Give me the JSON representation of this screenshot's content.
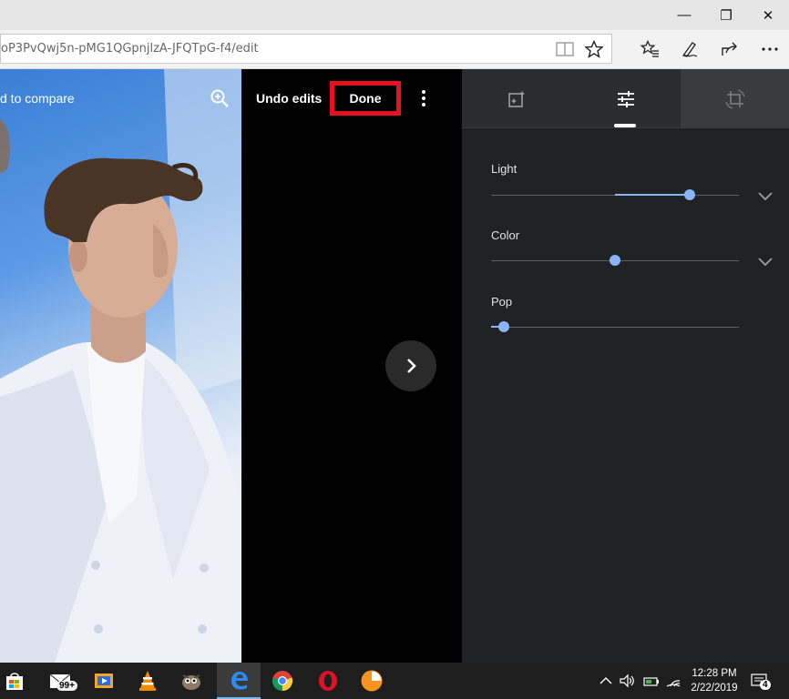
{
  "browser": {
    "window_buttons": {
      "minimize": "—",
      "maximize": "❐",
      "close": "✕"
    },
    "address": "oP3PvQwj5n-pMG1QGpnjlzA-JFQTpG-f4/edit",
    "toolbar_icons": [
      "reading-view-icon",
      "favorite-star-icon",
      "favorites-list-icon",
      "pen-icon",
      "share-icon",
      "more-icon"
    ]
  },
  "photo": {
    "compare_hint": "d to compare"
  },
  "editor": {
    "undo_label": "Undo edits",
    "done_label": "Done",
    "accent_highlight": "#e81123"
  },
  "panel": {
    "tabs": [
      {
        "id": "auto-enhance",
        "icon": "auto-enhance-icon"
      },
      {
        "id": "adjust",
        "icon": "adjust-sliders-icon",
        "active": true
      },
      {
        "id": "crop-rotate",
        "icon": "crop-rotate-icon"
      }
    ],
    "sliders": [
      {
        "label": "Light",
        "value": 0.8,
        "center": 0.5,
        "expandable": true
      },
      {
        "label": "Color",
        "value": 0.5,
        "center": 0.5,
        "expandable": true
      },
      {
        "label": "Pop",
        "value": 0.05,
        "center": 0.0,
        "expandable": false
      }
    ],
    "slider_color": "#8ab4f8"
  },
  "taskbar": {
    "apps": [
      "store-icon",
      "mail-icon",
      "media-player-icon",
      "vlc-icon",
      "gimp-icon",
      "edge-icon",
      "chrome-icon",
      "opera-icon",
      "clock-app-icon"
    ],
    "mail_badge": "99+",
    "time": "12:28 PM",
    "date": "2/22/2019",
    "notifications": "4"
  }
}
